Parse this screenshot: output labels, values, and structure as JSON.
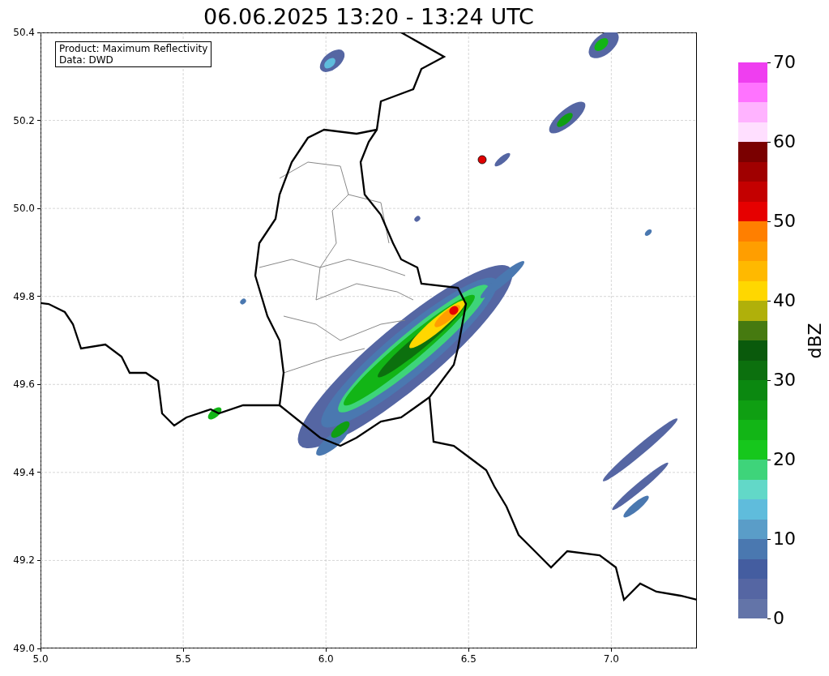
{
  "title": "06.06.2025 13:20 - 13:24 UTC",
  "map": {
    "annotation": [
      "Product: Maximum Reflectivity",
      "Data: DWD"
    ],
    "yticks": [
      "50.4",
      "50.2",
      "50.0",
      "49.8",
      "49.6",
      "49.4",
      "49.2",
      "49.0"
    ],
    "xticks": [
      "5.0",
      "5.5",
      "6.0",
      "6.5",
      "7.0"
    ]
  },
  "colorbar": {
    "label": "dBZ",
    "ticks": [
      "70",
      "60",
      "50",
      "40",
      "30",
      "20",
      "10",
      "0"
    ],
    "segments": [
      {
        "color": "#ef3ef0"
      },
      {
        "color": "#ff73ff"
      },
      {
        "color": "#ffb3ff"
      },
      {
        "color": "#ffdfff"
      },
      {
        "color": "#7a0000"
      },
      {
        "color": "#a00000"
      },
      {
        "color": "#c40000"
      },
      {
        "color": "#e60000"
      },
      {
        "color": "#ff7f00"
      },
      {
        "color": "#ff9e00"
      },
      {
        "color": "#ffb900"
      },
      {
        "color": "#ffd700"
      },
      {
        "color": "#b0b00a"
      },
      {
        "color": "#467a10"
      },
      {
        "color": "#0a5a0c"
      },
      {
        "color": "#0c700e"
      },
      {
        "color": "#0b8810"
      },
      {
        "color": "#0f9f12"
      },
      {
        "color": "#12b516"
      },
      {
        "color": "#16c71c"
      },
      {
        "color": "#3ed47a"
      },
      {
        "color": "#62d8c8"
      },
      {
        "color": "#5fbcdc"
      },
      {
        "color": "#5a9dc8"
      },
      {
        "color": "#4a78b0"
      },
      {
        "color": "#445da0"
      },
      {
        "color": "#5566a3"
      },
      {
        "color": "#6374a8"
      }
    ]
  }
}
